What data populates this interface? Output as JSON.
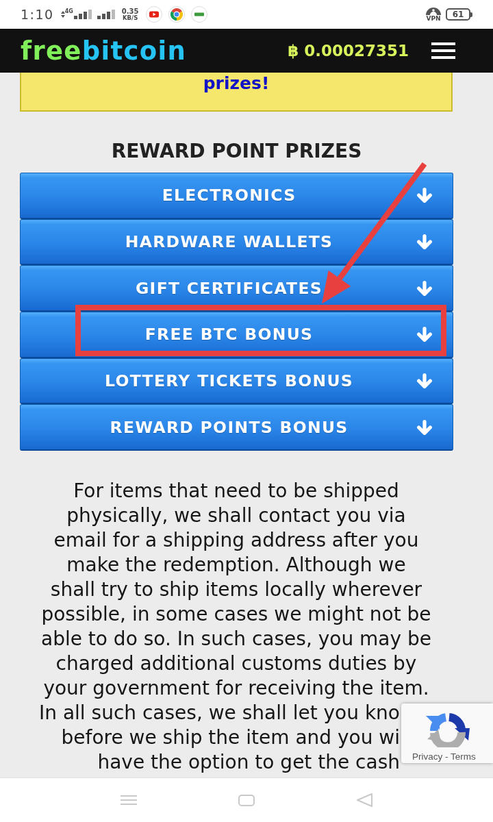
{
  "status_bar": {
    "time": "1:10",
    "network_type": "4G",
    "speed": "0.35",
    "speed_unit": "KB/S",
    "vpn_label": "VPN",
    "battery": "61"
  },
  "header": {
    "logo": [
      {
        "text": "free",
        "color": "#80ef5a"
      },
      {
        "text": "bitcoin",
        "color": "#26c4f4"
      }
    ],
    "balance": "฿ 0.00027351"
  },
  "banner": {
    "text": "prizes!"
  },
  "section": {
    "title": "REWARD POINT PRIZES",
    "categories": [
      {
        "label": "ELECTRONICS",
        "expanded": false,
        "highlighted": false
      },
      {
        "label": "HARDWARE WALLETS",
        "expanded": false,
        "highlighted": false
      },
      {
        "label": "GIFT CERTIFICATES",
        "expanded": false,
        "highlighted": false
      },
      {
        "label": "FREE BTC BONUS",
        "expanded": false,
        "highlighted": true
      },
      {
        "label": "LOTTERY TICKETS BONUS",
        "expanded": false,
        "highlighted": false
      },
      {
        "label": "REWARD POINTS BONUS",
        "expanded": false,
        "highlighted": false
      }
    ]
  },
  "notice": {
    "text": "For items that need to be shipped\nphysically, we shall contact you via\nemail for a shipping address after you\nmake the redemption. Although we\nshall try to ship items locally wherever\npossible, in some cases we might not be\nable to do so. In such cases, you may be\ncharged additional customs duties by\nyour government for receiving the item.",
    "continuation": "In all such cases, we shall let you kno\nbefore we ship the item and you wi\nhave the option to get the cash"
  },
  "privacy_badge": {
    "text": "Privacy - Terms"
  }
}
